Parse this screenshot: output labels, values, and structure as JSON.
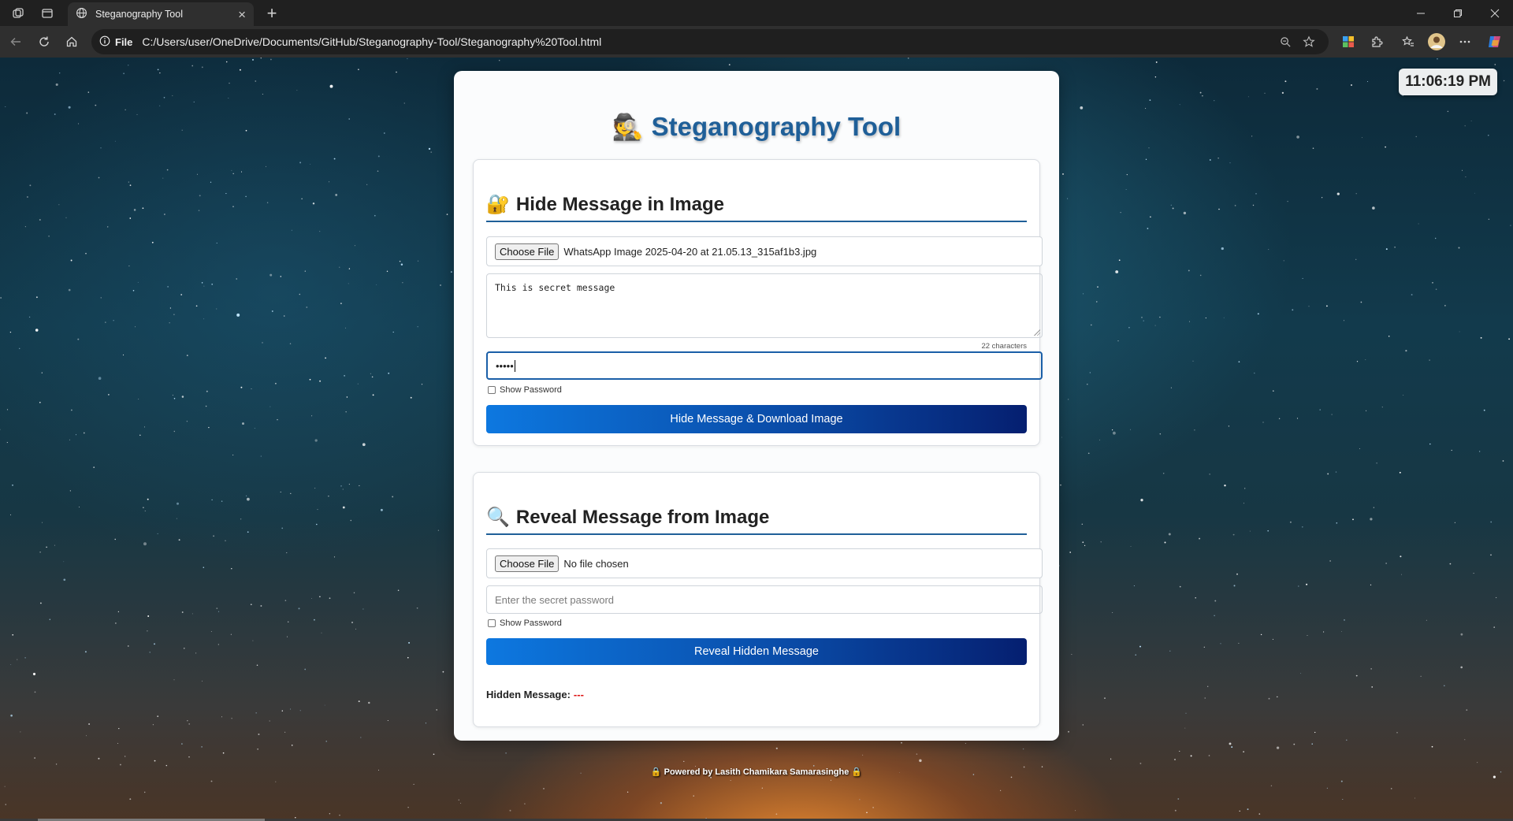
{
  "browser": {
    "tab_title": "Steganography Tool",
    "address_label": "File",
    "url": "C:/Users/user/OneDrive/Documents/GitHub/Steganography-Tool/Steganography%20Tool.html"
  },
  "clock": "11:06:19 PM",
  "page": {
    "title": "Steganography Tool",
    "title_emoji": "🕵️",
    "footer": "🔒 Powered by Lasith Chamikara Samarasinghe 🔒"
  },
  "hide": {
    "heading": "Hide Message in Image",
    "heading_emoji": "🔐",
    "choose_file_label": "Choose File",
    "file_name": "WhatsApp Image 2025-04-20 at 21.05.13_315af1b3.jpg",
    "message": "This is secret message",
    "char_count": "22 characters",
    "password_masked": "•••••",
    "show_password_label": "Show Password",
    "button_label": "Hide Message & Download Image"
  },
  "reveal": {
    "heading": "Reveal Message from Image",
    "heading_emoji": "🔍",
    "choose_file_label": "Choose File",
    "file_name": "No file chosen",
    "password_placeholder": "Enter the secret password",
    "show_password_label": "Show Password",
    "button_label": "Reveal Hidden Message",
    "result_label": "Hidden Message:",
    "result_value": "---"
  }
}
